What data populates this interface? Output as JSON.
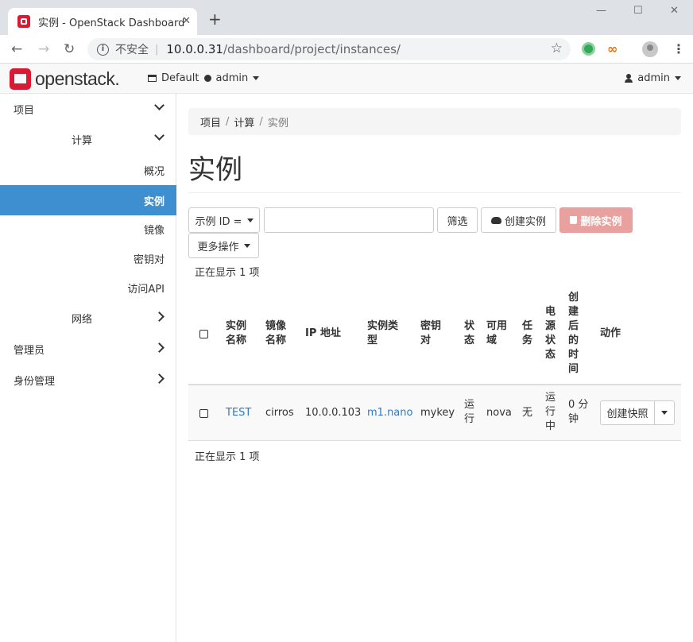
{
  "browser": {
    "tab_title": "实例 - OpenStack Dashboard",
    "tab_close": "✕",
    "new_tab": "+",
    "insecure_label": "不安全",
    "url_host": "10.0.0.31",
    "url_path": "/dashboard/project/instances/"
  },
  "topnav": {
    "logo_text": "openstack.",
    "project_domain": "Default",
    "project_name": "admin",
    "user_name": "admin"
  },
  "sidebar": {
    "project": "项目",
    "compute": "计算",
    "overview": "概况",
    "instances": "实例",
    "images": "镜像",
    "keypairs": "密钥对",
    "api_access": "访问API",
    "network": "网络",
    "admin": "管理员",
    "identity": "身份管理"
  },
  "breadcrumb": {
    "item1": "项目",
    "item2": "计算",
    "item3": "实例",
    "sep": "/"
  },
  "page_title": "实例",
  "toolbar": {
    "filter_field": "示例 ID =",
    "filter_value": "",
    "filter_button": "筛选",
    "launch_button": "创建实例",
    "delete_button": "删除实例",
    "more_actions": "更多操作"
  },
  "count_top": "正在显示 1 项",
  "count_bottom": "正在显示 1 项",
  "table": {
    "headers": {
      "name": [
        "实例",
        "名称"
      ],
      "image": [
        "镜像",
        "名称"
      ],
      "ip": [
        "IP 地址"
      ],
      "flavor": [
        "实例类",
        "型"
      ],
      "keypair": [
        "密钥",
        "对"
      ],
      "status": [
        "状",
        "态"
      ],
      "az": [
        "可用",
        "域"
      ],
      "task": [
        "任",
        "务"
      ],
      "power": [
        "电",
        "源",
        "状",
        "态"
      ],
      "age": [
        "创",
        "建",
        "后",
        "的",
        "时",
        "间"
      ],
      "actions": [
        "动作"
      ]
    },
    "rows": [
      {
        "name": "TEST",
        "image": "cirros",
        "ip": "10.0.0.103",
        "flavor": "m1.nano",
        "keypair": "mykey",
        "status": [
          "运",
          "行"
        ],
        "az": "nova",
        "task": "无",
        "power": [
          "运",
          "行",
          "中"
        ],
        "age": [
          "0 分",
          "钟"
        ],
        "action_label": "创建快照"
      }
    ]
  }
}
